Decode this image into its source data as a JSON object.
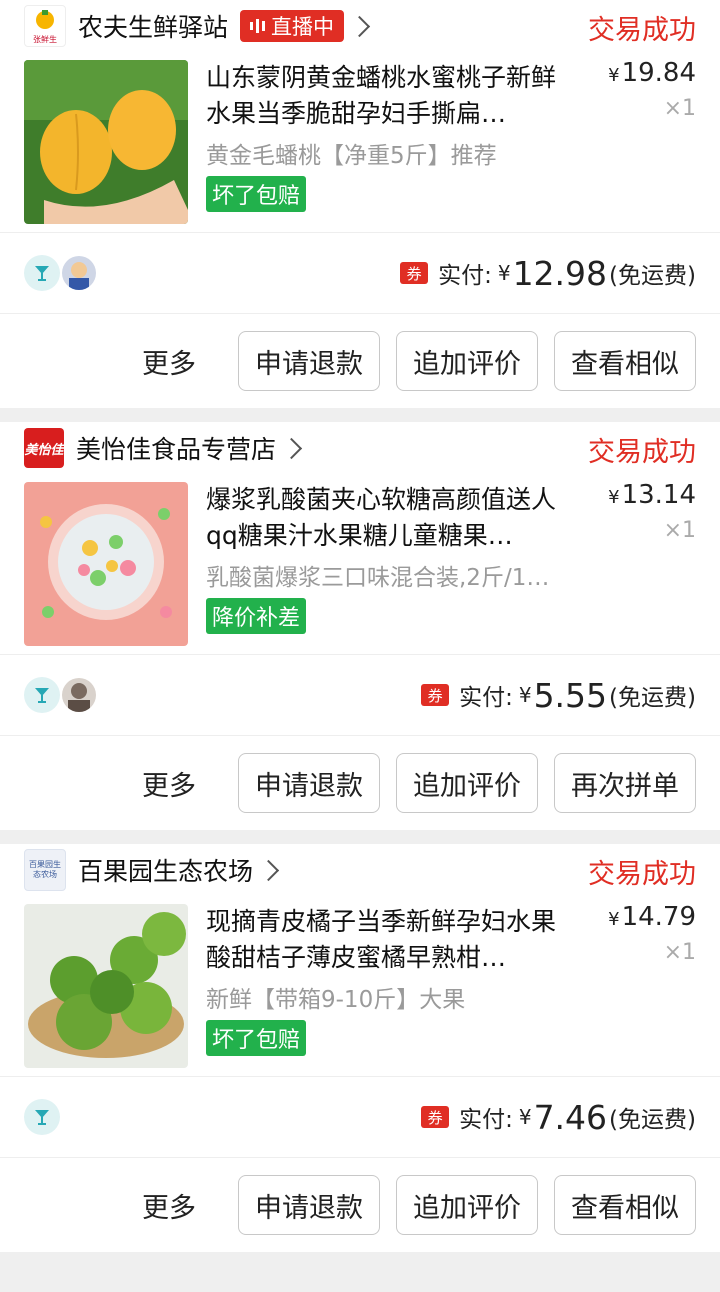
{
  "orders": [
    {
      "shop": {
        "name": "农夫生鲜驿站",
        "logo_text": "张鲜生",
        "live_badge": "直播中"
      },
      "status": "交易成功",
      "product": {
        "title": "山东蒙阴黄金蟠桃水蜜桃子新鲜水果当季脆甜孕妇手撕扁…",
        "spec": "黄金毛蟠桃【净重5斤】推荐",
        "tag": "坏了包赔",
        "price": "19.84",
        "qty": "×1"
      },
      "payment": {
        "coupon": "券",
        "label": "实付:",
        "currency": "¥",
        "amount": "12.98",
        "note": "(免运费)"
      },
      "buttons": {
        "more": "更多",
        "b1": "申请退款",
        "b2": "追加评价",
        "b3": "查看相似"
      }
    },
    {
      "shop": {
        "name": "美怡佳食品专营店",
        "logo_text": "美怡佳"
      },
      "status": "交易成功",
      "product": {
        "title": "爆浆乳酸菌夹心软糖高颜值送人qq糖果汁水果糖儿童糖果…",
        "spec": "乳酸菌爆浆三口味混合装,2斤/1…",
        "tag": "降价补差",
        "price": "13.14",
        "qty": "×1"
      },
      "payment": {
        "coupon": "券",
        "label": "实付:",
        "currency": "¥",
        "amount": "5.55",
        "note": "(免运费)"
      },
      "buttons": {
        "more": "更多",
        "b1": "申请退款",
        "b2": "追加评价",
        "b3": "再次拼单"
      }
    },
    {
      "shop": {
        "name": "百果园生态农场",
        "logo_text": "百果园生态农场"
      },
      "status": "交易成功",
      "product": {
        "title": "现摘青皮橘子当季新鲜孕妇水果酸甜桔子薄皮蜜橘早熟柑…",
        "spec": "新鲜【带箱9-10斤】大果",
        "tag": "坏了包赔",
        "price": "14.79",
        "qty": "×1"
      },
      "payment": {
        "coupon": "券",
        "label": "实付:",
        "currency": "¥",
        "amount": "7.46",
        "note": "(免运费)"
      },
      "buttons": {
        "more": "更多",
        "b1": "申请退款",
        "b2": "追加评价",
        "b3": "查看相似"
      }
    }
  ],
  "colors": {
    "accent_red": "#e02e24",
    "tag_green": "#22b14c"
  }
}
